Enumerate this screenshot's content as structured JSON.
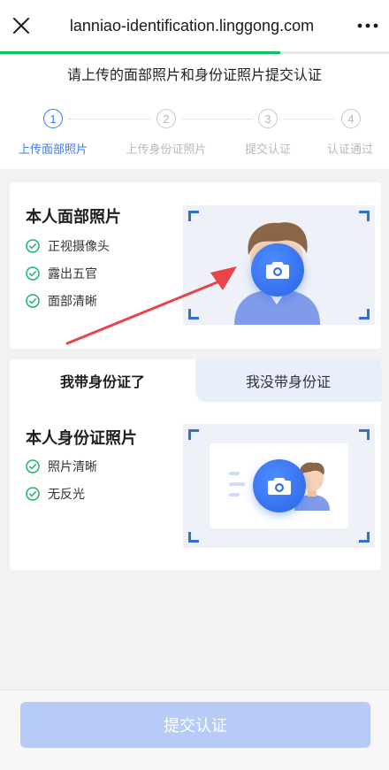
{
  "browser": {
    "url": "lanniao-identification.linggong.com",
    "load_progress": 0.72
  },
  "header": {
    "instruction": "请上传的面部照片和身份证照片提交认证"
  },
  "steps": [
    {
      "number": "1",
      "label": "上传面部照片",
      "active": true
    },
    {
      "number": "2",
      "label": "上传身份证照片",
      "active": false
    },
    {
      "number": "3",
      "label": "提交认证",
      "active": false
    },
    {
      "number": "4",
      "label": "认证通过",
      "active": false
    }
  ],
  "face_card": {
    "title": "本人面部照片",
    "requirements": [
      "正视摄像头",
      "露出五官",
      "面部清晰"
    ]
  },
  "id_tabs": {
    "tab_have": "我带身份证了",
    "tab_not_have": "我没带身份证"
  },
  "id_card": {
    "title": "本人身份证照片",
    "requirements": [
      "照片清晰",
      "无反光"
    ]
  },
  "footer": {
    "submit_label": "提交认证"
  },
  "colors": {
    "accent": "#3a7bf0",
    "check": "#1bb56b",
    "progress": "#07c160",
    "submit_disabled": "#b7cbf7"
  },
  "icons": {
    "close": "close-icon",
    "more": "more-dots-icon",
    "camera": "camera-icon",
    "check": "check-circle-icon",
    "arrow": "arrow-annotation"
  }
}
